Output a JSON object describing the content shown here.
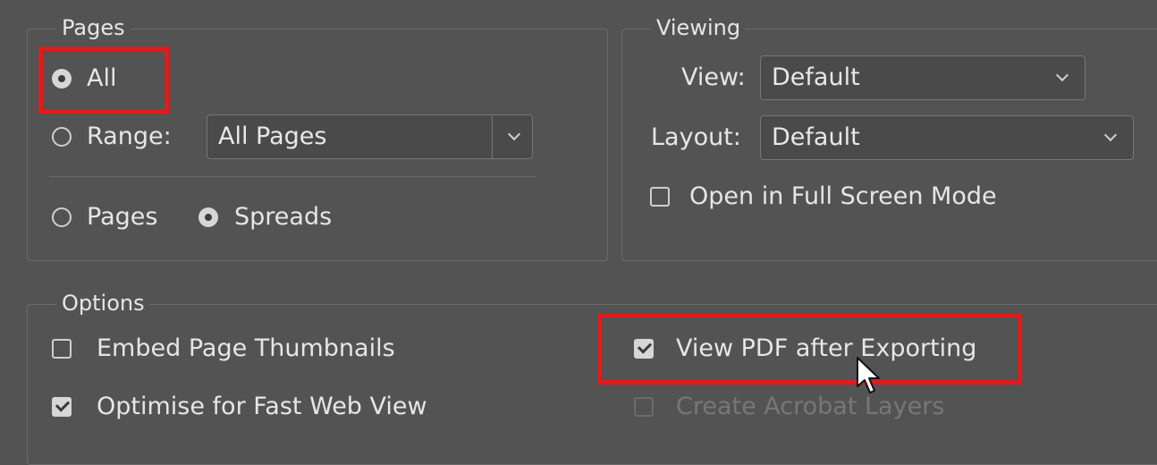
{
  "pages": {
    "legend": "Pages",
    "all_label": "All",
    "range_label": "Range:",
    "range_value": "All Pages",
    "pages_label": "Pages",
    "spreads_label": "Spreads"
  },
  "viewing": {
    "legend": "Viewing",
    "view_label": "View:",
    "view_value": "Default",
    "layout_label": "Layout:",
    "layout_value": "Default",
    "fullscreen_label": "Open in Full Screen Mode"
  },
  "options": {
    "legend": "Options",
    "embed_thumbnails": "Embed Page Thumbnails",
    "optimise_fast_web": "Optimise for Fast Web View",
    "view_pdf_after": "View PDF after Exporting",
    "create_acrobat_layers": "Create Acrobat Layers"
  },
  "colors": {
    "background": "#535353",
    "highlight": "#e01b1b"
  }
}
